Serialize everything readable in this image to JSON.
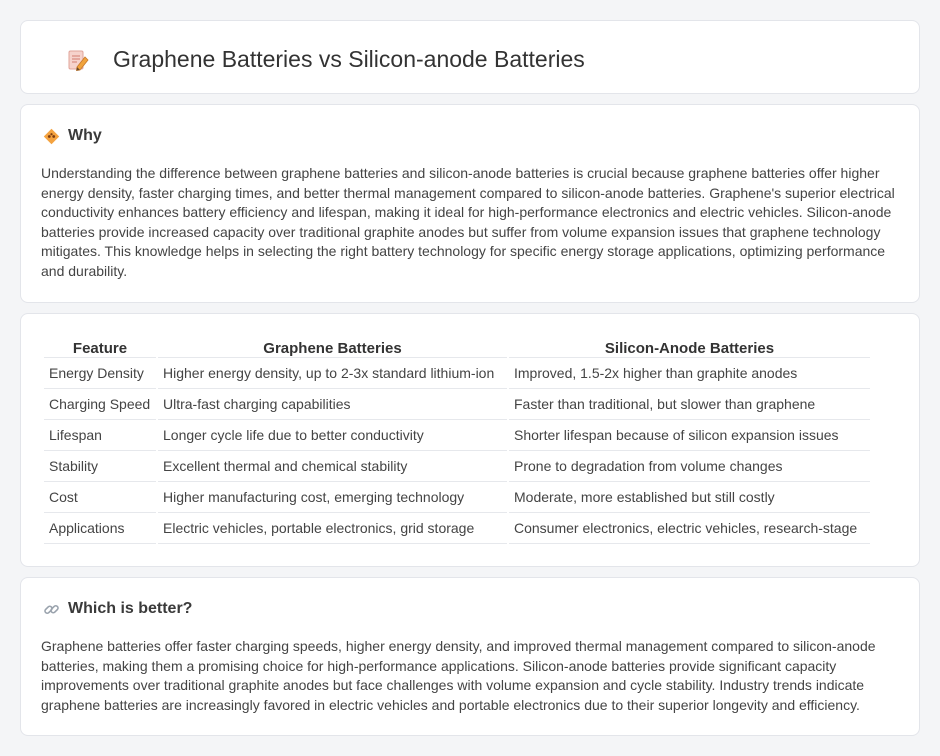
{
  "header": {
    "title": "Graphene Batteries vs Silicon-anode Batteries",
    "icon": "document-pencil-icon"
  },
  "why": {
    "icon": "sparkle-diamond-icon",
    "title": "Why",
    "text": "Understanding the difference between graphene batteries and silicon-anode batteries is crucial because graphene batteries offer higher energy density, faster charging times, and better thermal management compared to silicon-anode batteries. Graphene's superior electrical conductivity enhances battery efficiency and lifespan, making it ideal for high-performance electronics and electric vehicles. Silicon-anode batteries provide increased capacity over traditional graphite anodes but suffer from volume expansion issues that graphene technology mitigates. This knowledge helps in selecting the right battery technology for specific energy storage applications, optimizing performance and durability."
  },
  "comparison": {
    "headers": [
      "Feature",
      "Graphene Batteries",
      "Silicon-Anode Batteries"
    ],
    "rows": [
      [
        "Energy Density",
        "Higher energy density, up to 2-3x standard lithium-ion",
        "Improved, 1.5-2x higher than graphite anodes"
      ],
      [
        "Charging Speed",
        "Ultra-fast charging capabilities",
        "Faster than traditional, but slower than graphene"
      ],
      [
        "Lifespan",
        "Longer cycle life due to better conductivity",
        "Shorter lifespan because of silicon expansion issues"
      ],
      [
        "Stability",
        "Excellent thermal and chemical stability",
        "Prone to degradation from volume changes"
      ],
      [
        "Cost",
        "Higher manufacturing cost, emerging technology",
        "Moderate, more established but still costly"
      ],
      [
        "Applications",
        "Electric vehicles, portable electronics, grid storage",
        "Consumer electronics, electric vehicles, research-stage"
      ]
    ]
  },
  "better": {
    "icon": "link-icon",
    "title": "Which is better?",
    "text": "Graphene batteries offer faster charging speeds, higher energy density, and improved thermal management compared to silicon-anode batteries, making them a promising choice for high-performance applications. Silicon-anode batteries provide significant capacity improvements over traditional graphite anodes but face challenges with volume expansion and cycle stability. Industry trends indicate graphene batteries are increasingly favored in electric vehicles and portable electronics due to their superior longevity and efficiency."
  },
  "colors": {
    "background": "#f4f5f7",
    "card": "#ffffff",
    "accent_orange": "#f4a340",
    "icon_pink": "#e8756a"
  }
}
